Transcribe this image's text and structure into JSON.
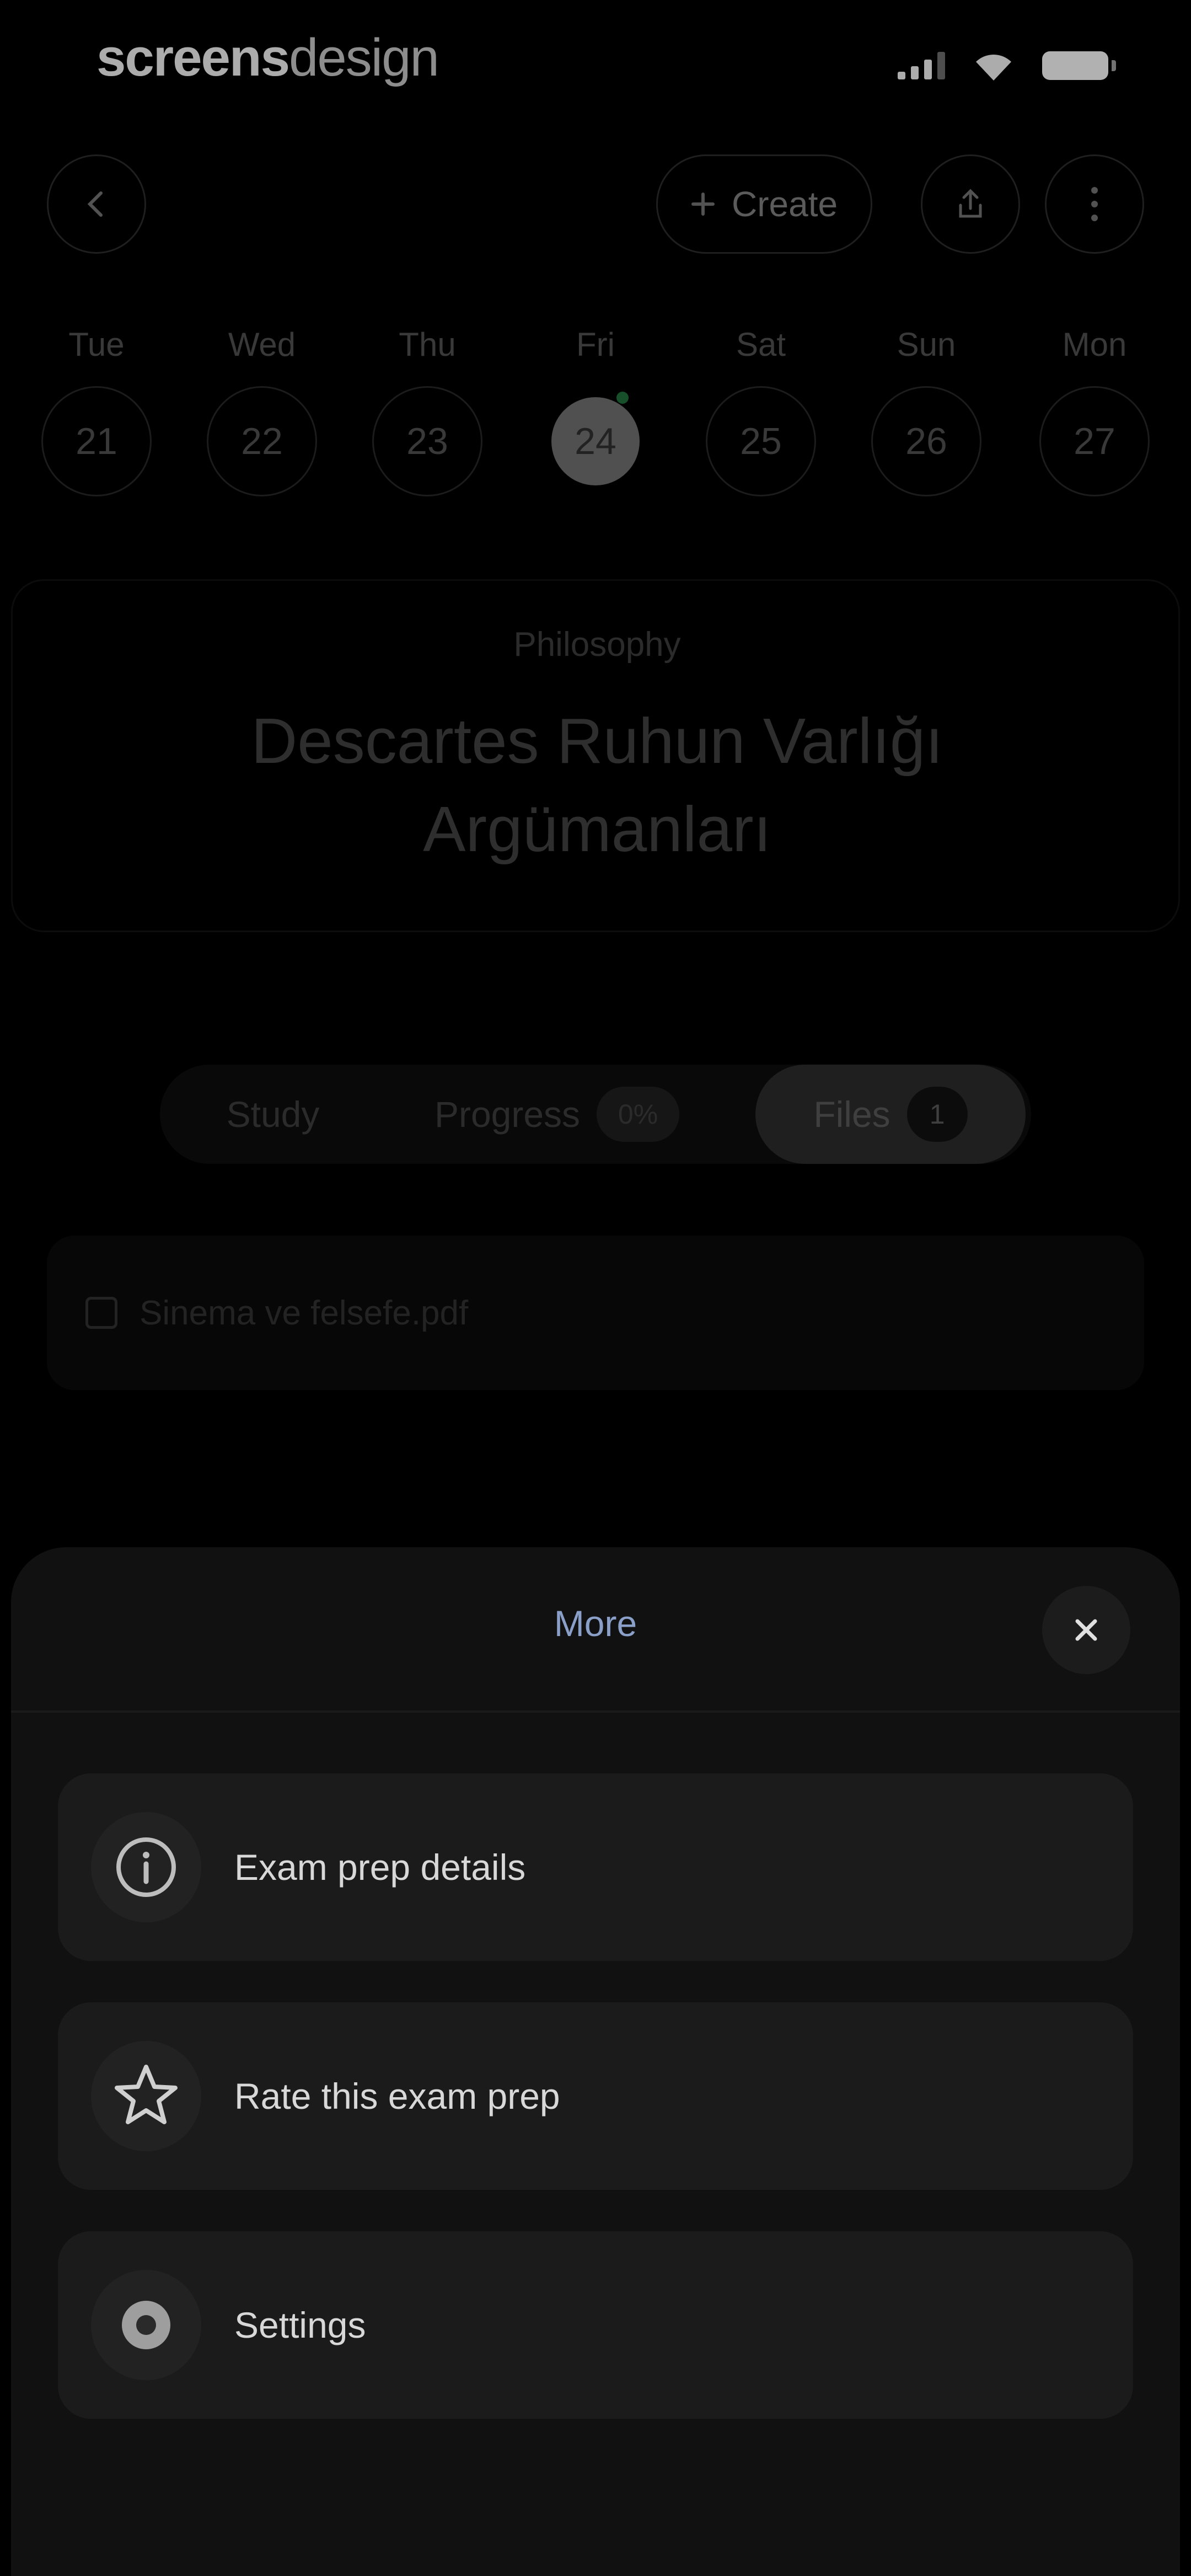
{
  "status_bar": {
    "brand_bold": "screens",
    "brand_light": "design"
  },
  "top_nav": {
    "back_icon": "chevron-left-icon",
    "create_label": "Create",
    "create_icon": "plus-icon",
    "share_icon": "share-icon",
    "more_icon": "vertical-dots-icon"
  },
  "week": {
    "days": [
      {
        "name": "Tue",
        "num": "21",
        "active": false
      },
      {
        "name": "Wed",
        "num": "22",
        "active": false
      },
      {
        "name": "Thu",
        "num": "23",
        "active": false
      },
      {
        "name": "Fri",
        "num": "24",
        "active": true
      },
      {
        "name": "Sat",
        "num": "25",
        "active": false
      },
      {
        "name": "Sun",
        "num": "26",
        "active": false
      },
      {
        "name": "Mon",
        "num": "27",
        "active": false
      }
    ]
  },
  "hero": {
    "subject": "Philosophy",
    "title": "Descartes Ruhun Varlığı Argümanları"
  },
  "tabs": [
    {
      "label": "Study",
      "badge": null,
      "active": false
    },
    {
      "label": "Progress",
      "badge": "0%",
      "active": false
    },
    {
      "label": "Files",
      "badge": "1",
      "active": true
    }
  ],
  "files": [
    {
      "name": "Sinema ve felsefe.pdf"
    }
  ],
  "sheet": {
    "title": "More",
    "close_icon": "close-icon",
    "items": [
      {
        "label": "Exam prep details",
        "icon": "info-icon"
      },
      {
        "label": "Rate this exam prep",
        "icon": "star-icon"
      },
      {
        "label": "Settings",
        "icon": "gear-icon"
      }
    ]
  },
  "colors": {
    "sheet_bg": "#111111",
    "item_bg": "#1b1b1b",
    "sheet_title": "#8aa0c8",
    "active_dot": "#1f6a3a"
  }
}
